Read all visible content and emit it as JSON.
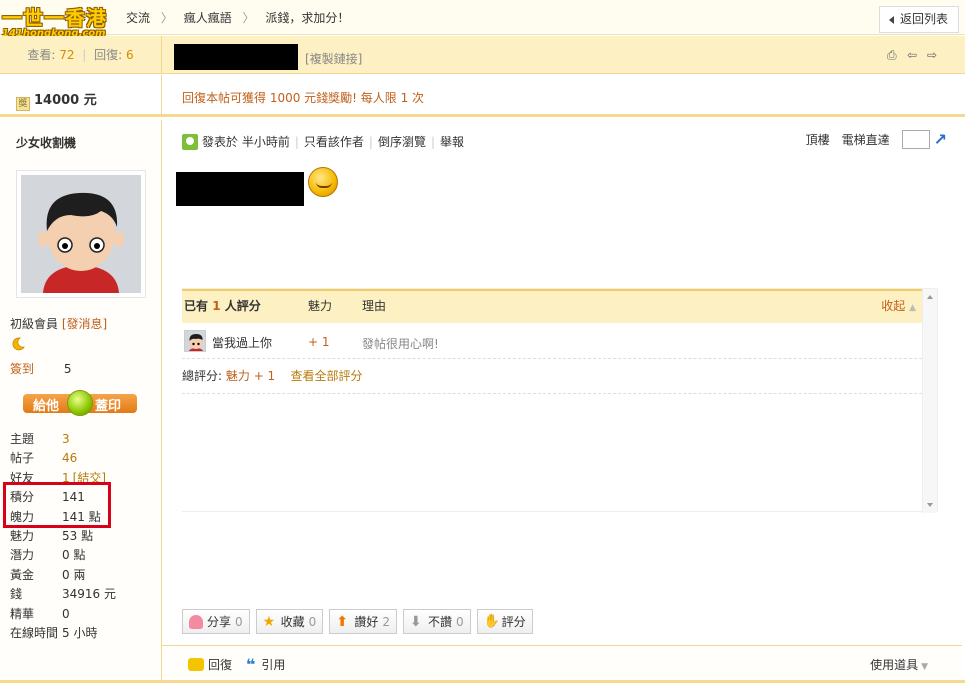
{
  "brand": {
    "logo_cn": "一世一香港",
    "logo_en": "141hongkong.com"
  },
  "breadcrumb": {
    "items": [
      "交流",
      "瘋人瘋語",
      "派錢，求加分！"
    ]
  },
  "back_button": "返回列表",
  "thread_stats": {
    "views_label": "查看:",
    "views": "72",
    "replies_label": "回復:",
    "replies": "6"
  },
  "thread": {
    "copy_link": "[複製鏈接]"
  },
  "reward": {
    "amount": "14000 元",
    "text": "回復本帖可獲得 1000 元錢獎勵! 每人限 1 次"
  },
  "user": {
    "name": "少女收割機",
    "level": "初級會員",
    "send_message": "[發消息]",
    "signin_label": "簽到",
    "signin_value": "5",
    "give_left": "給他",
    "give_right": "蓋印",
    "stats": [
      {
        "label": "主題",
        "value": "3",
        "link": true
      },
      {
        "label": "帖子",
        "value": "46",
        "link": true
      },
      {
        "label": "好友",
        "value": "1",
        "extra": "[結交]",
        "link": true
      },
      {
        "label": "積分",
        "value": "141",
        "link": false
      },
      {
        "label": "魄力",
        "value": "141 點",
        "link": false
      },
      {
        "label": "魅力",
        "value": "53 點",
        "link": false
      },
      {
        "label": "潛力",
        "value": "0 點",
        "link": false
      },
      {
        "label": "黃金",
        "value": "0 兩",
        "link": false
      },
      {
        "label": "錢",
        "value": "34916 元",
        "link": false
      },
      {
        "label": "精華",
        "value": "0",
        "link": false
      },
      {
        "label": "在線時間",
        "value": "5 小時",
        "link": false
      }
    ]
  },
  "post_meta": {
    "posted": "發表於 半小時前",
    "only_author": "只看該作者",
    "reverse": "倒序瀏覽",
    "report": "舉報",
    "top": "頂樓",
    "elevator": "電梯直達"
  },
  "rating": {
    "head_prefix": "已有",
    "head_count": "1",
    "head_suffix": "人評分",
    "col_charm": "魅力",
    "col_reason": "理由",
    "collapse": "收起",
    "rows": [
      {
        "name": "當我過上你",
        "points": "+ 1",
        "reason": "發帖很用心啊!"
      }
    ],
    "total_label": "總評分:",
    "total_value": "魅力 + 1",
    "view_all": "查看全部評分"
  },
  "actions": [
    {
      "icon": "heart-icon",
      "label": "分享",
      "count": "0"
    },
    {
      "icon": "star-icon",
      "label": "收藏",
      "count": "0"
    },
    {
      "icon": "thumb-up-icon",
      "label": "讚好",
      "count": "2"
    },
    {
      "icon": "thumb-down-icon",
      "label": "不讚",
      "count": "0"
    },
    {
      "icon": "rate-icon",
      "label": "評分",
      "count": ""
    }
  ],
  "bottom": {
    "reply": "回復",
    "quote": "引用",
    "tools": "使用道具"
  },
  "colors": {
    "accent_orange": "#c0601a",
    "header_bg": "#fdf0c3",
    "highlight_red": "#d9001a"
  }
}
